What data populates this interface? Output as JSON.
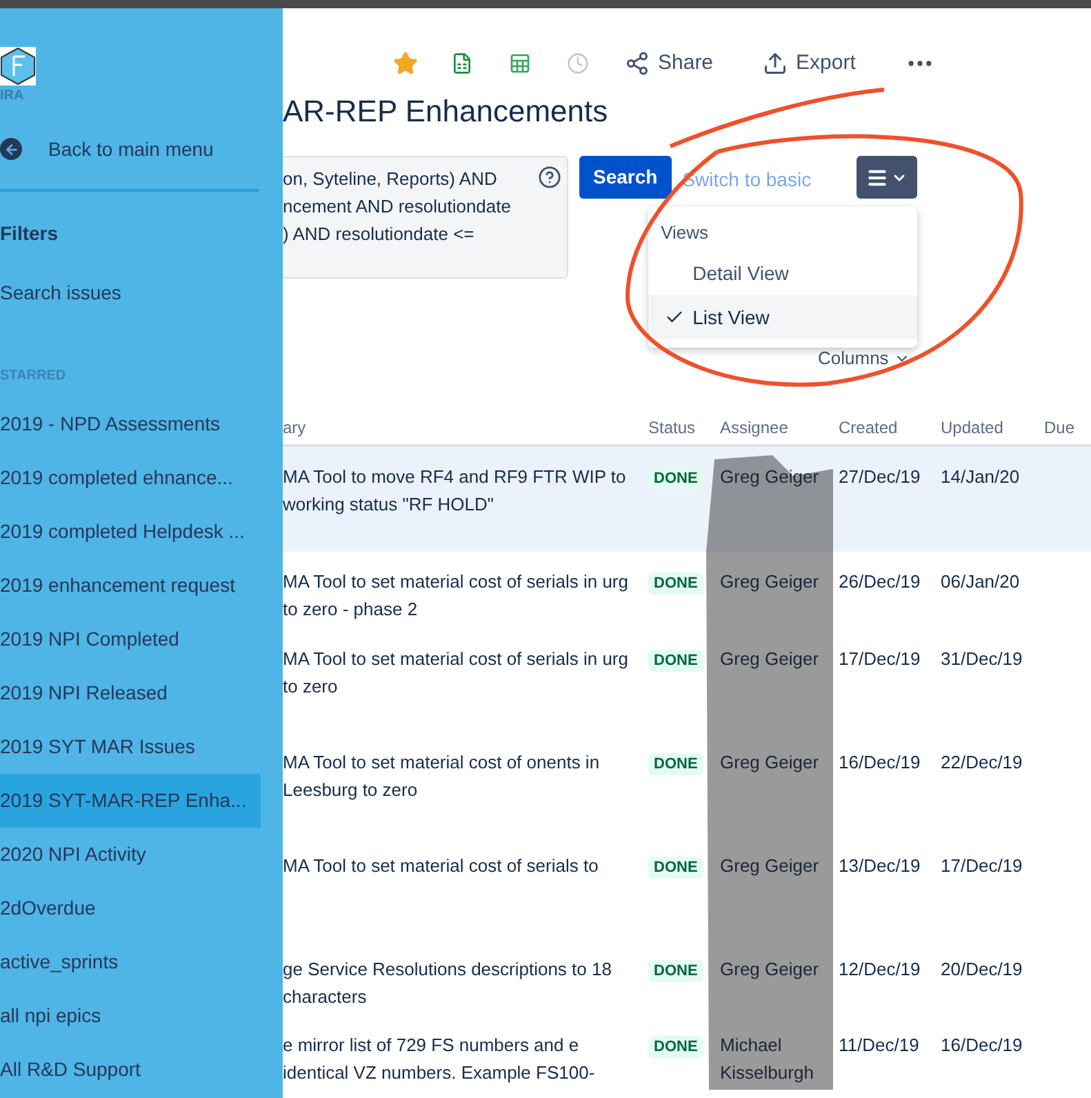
{
  "sidebar": {
    "logo_text": "IRA",
    "back_link": "Back to main menu",
    "section_title": "Filters",
    "search_link": "Search issues",
    "starred_heading": "STARRED",
    "items": [
      {
        "label": "2019 - NPD Assessments",
        "selected": false
      },
      {
        "label": "2019 completed ehnance...",
        "selected": false
      },
      {
        "label": "2019 completed Helpdesk ...",
        "selected": false
      },
      {
        "label": "2019 enhancement request",
        "selected": false
      },
      {
        "label": "2019 NPI Completed",
        "selected": false
      },
      {
        "label": "2019 NPI Released",
        "selected": false
      },
      {
        "label": "2019 SYT MAR Issues",
        "selected": false
      },
      {
        "label": "2019 SYT-MAR-REP Enha...",
        "selected": true
      },
      {
        "label": "2020 NPI Activity",
        "selected": false
      },
      {
        "label": "2dOverdue",
        "selected": false
      },
      {
        "label": "active_sprints",
        "selected": false
      },
      {
        "label": "all npi epics",
        "selected": false
      },
      {
        "label": "All R&D Support",
        "selected": false
      }
    ]
  },
  "toolbar": [
    {
      "kind": "star",
      "starred": true
    },
    {
      "kind": "excel",
      "disabled": false
    },
    {
      "kind": "sheets",
      "disabled": false
    },
    {
      "kind": "clock",
      "disabled": true
    },
    {
      "kind": "share",
      "label": "Share"
    },
    {
      "kind": "export",
      "label": "Export"
    },
    {
      "kind": "more"
    }
  ],
  "title": "AR-REP Enhancements",
  "query": {
    "lines": [
      "on, Syteline, Reports) AND",
      "ncement AND resolutiondate",
      ") AND resolutiondate <="
    ]
  },
  "search_button": "Search",
  "switch_link": "Switch to basic",
  "view_menu": {
    "open": true,
    "heading": "Views",
    "items": [
      {
        "label": "Detail View",
        "selected": false
      },
      {
        "label": "List View",
        "selected": true
      }
    ]
  },
  "columns_link": "Columns",
  "table": {
    "columns": [
      "ary",
      "Status",
      "Assignee",
      "Created",
      "Updated",
      "Due"
    ],
    "rows": [
      {
        "summary": "MA Tool to move RF4 and RF9 FTR WIP to working status \"RF HOLD\"",
        "status": "DONE",
        "assignee": "Greg Geiger",
        "created": "27/Dec/19",
        "updated": "14/Jan/20",
        "selected": true
      },
      {
        "summary": "MA Tool to set material cost of serials in urg to zero - phase 2",
        "status": "DONE",
        "assignee": "Greg Geiger",
        "created": "26/Dec/19",
        "updated": "06/Jan/20",
        "selected": false
      },
      {
        "summary": "MA Tool to set material cost of serials in urg to zero",
        "status": "DONE",
        "assignee": "Greg Geiger",
        "created": "17/Dec/19",
        "updated": "31/Dec/19",
        "selected": false
      },
      {
        "summary": "MA Tool to set material cost of onents in Leesburg to zero",
        "status": "DONE",
        "assignee": "Greg Geiger",
        "created": "16/Dec/19",
        "updated": "22/Dec/19",
        "selected": false
      },
      {
        "summary": "MA Tool to set material cost of serials to",
        "status": "DONE",
        "assignee": "Greg Geiger",
        "created": "13/Dec/19",
        "updated": "17/Dec/19",
        "selected": false
      },
      {
        "summary": "ge Service Resolutions descriptions to 18 characters",
        "status": "DONE",
        "assignee": "Greg Geiger",
        "created": "12/Dec/19",
        "updated": "20/Dec/19",
        "selected": false
      },
      {
        "summary": "e mirror list of 729 FS numbers and e identical VZ numbers. Example FS100-",
        "status": "DONE",
        "assignee": "Michael Kisselburgh",
        "created": "11/Dec/19",
        "updated": "16/Dec/19",
        "selected": false
      }
    ]
  }
}
